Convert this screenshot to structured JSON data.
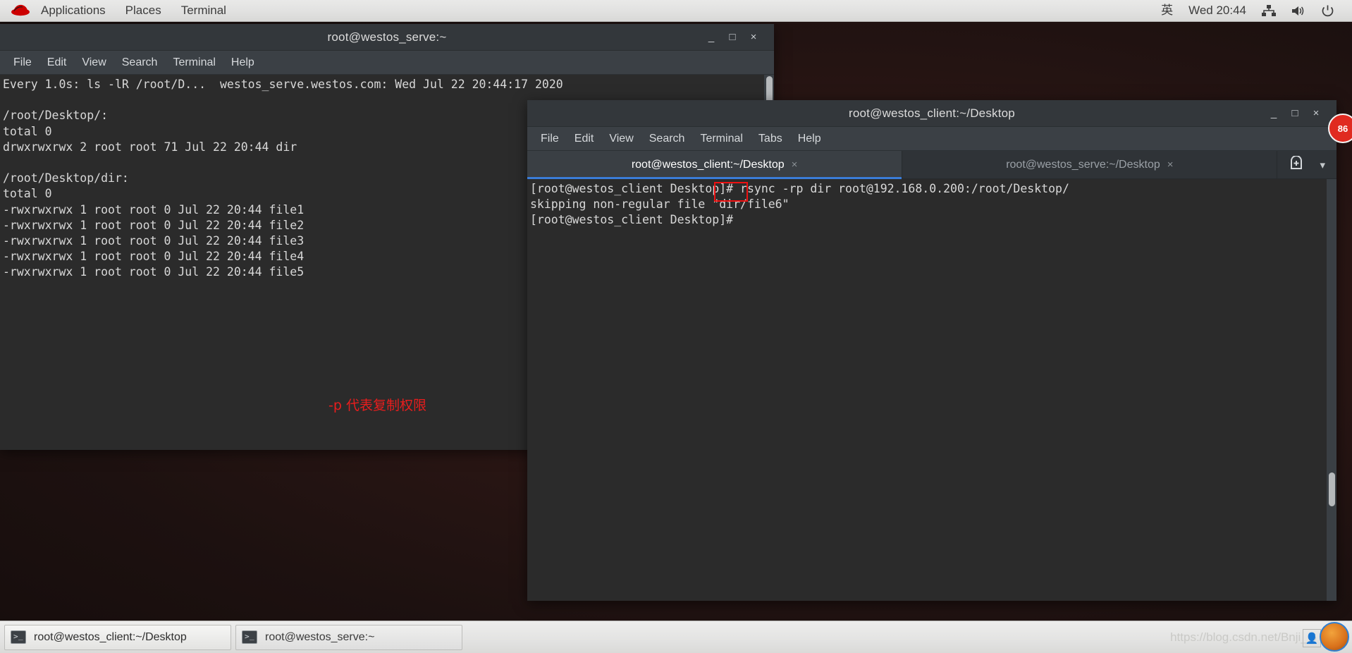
{
  "top_panel": {
    "logo_icon": "redhat-logo-icon",
    "items": [
      "Applications",
      "Places",
      "Terminal"
    ],
    "input_method": "英",
    "clock": "Wed 20:44",
    "tray": [
      "network-icon",
      "volume-icon",
      "power-icon"
    ]
  },
  "window_serve": {
    "title": "root@westos_serve:~",
    "menu": [
      "File",
      "Edit",
      "View",
      "Search",
      "Terminal",
      "Help"
    ],
    "buttons": {
      "minimize": "_",
      "maximize": "□",
      "close": "×"
    },
    "lines": [
      "Every 1.0s: ls -lR /root/D...  westos_serve.westos.com: Wed Jul 22 20:44:17 2020",
      "",
      "/root/Desktop/:",
      "total 0",
      "drwxrwxrwx 2 root root 71 Jul 22 20:44 dir",
      "",
      "/root/Desktop/dir:",
      "total 0",
      "-rwxrwxrwx 1 root root 0 Jul 22 20:44 file1",
      "-rwxrwxrwx 1 root root 0 Jul 22 20:44 file2",
      "-rwxrwxrwx 1 root root 0 Jul 22 20:44 file3",
      "-rwxrwxrwx 1 root root 0 Jul 22 20:44 file4",
      "-rwxrwxrwx 1 root root 0 Jul 22 20:44 file5"
    ]
  },
  "window_client": {
    "title": "root@westos_client:~/Desktop",
    "menu": [
      "File",
      "Edit",
      "View",
      "Search",
      "Terminal",
      "Tabs",
      "Help"
    ],
    "buttons": {
      "minimize": "_",
      "maximize": "□",
      "close": "×"
    },
    "tabs": [
      {
        "label": "root@westos_client:~/Desktop",
        "close": "×",
        "active": true
      },
      {
        "label": "root@westos_serve:~/Desktop",
        "close": "×",
        "active": false
      }
    ],
    "tab_tools": {
      "new_tab": "new-tab-icon",
      "menu": "▾"
    },
    "lines": [
      "[root@westos_client Desktop]# rsync -rp dir root@192.168.0.200:/root/Desktop/",
      "skipping non-regular file \"dir/file6\"",
      "[root@westos_client Desktop]#"
    ]
  },
  "annotation": {
    "text": "-p 代表复制权限",
    "color": "#e81d1d",
    "highlight_target": "-rp",
    "highlight_color": "#ee1111"
  },
  "side_badge": {
    "text": "86",
    "color": "#e02a20"
  },
  "taskbar": {
    "tasks": [
      {
        "label": "root@westos_client:~/Desktop",
        "icon": "terminal-icon",
        "active": true
      },
      {
        "label": "root@westos_serve:~",
        "icon": "terminal-icon",
        "active": false
      }
    ],
    "watermark": "https://blog.csdn.net/Bnji_G"
  }
}
